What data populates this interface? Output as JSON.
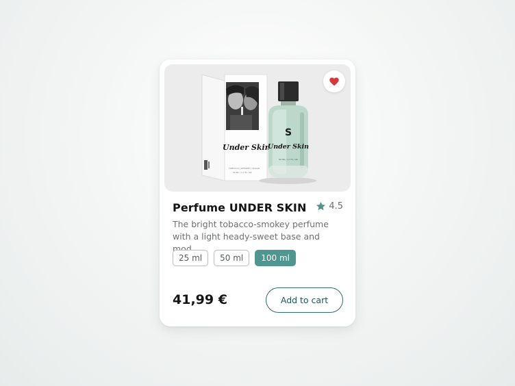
{
  "product": {
    "title": "Perfume UNDER SKIN",
    "rating": "4.5",
    "description": "The bright tobacco-smokey perfume with a light heady-sweet base and mod...",
    "sizes": [
      "25 ml",
      "50 ml",
      "100 ml"
    ],
    "selected_size": "100 ml",
    "price": "41,99 €",
    "add_to_cart_label": "Add to cart",
    "image": {
      "box_script": "Under Skin",
      "bottle_script": "Under Skin",
      "bottle_logo": "S",
      "box_tagline": "TOBACCO | WHISKEY | SUGAR",
      "box_volume": "50 ML / 1.7 FL. OZ",
      "bottle_volume": "50 ML / 1.7 FL. OZ"
    }
  },
  "icons": {
    "favorite": "heart-icon",
    "rating": "star-icon"
  },
  "colors": {
    "accent": "#4f9690",
    "heart": "#d33b3b",
    "star": "#4f9690",
    "button_border": "#2f6f68"
  }
}
